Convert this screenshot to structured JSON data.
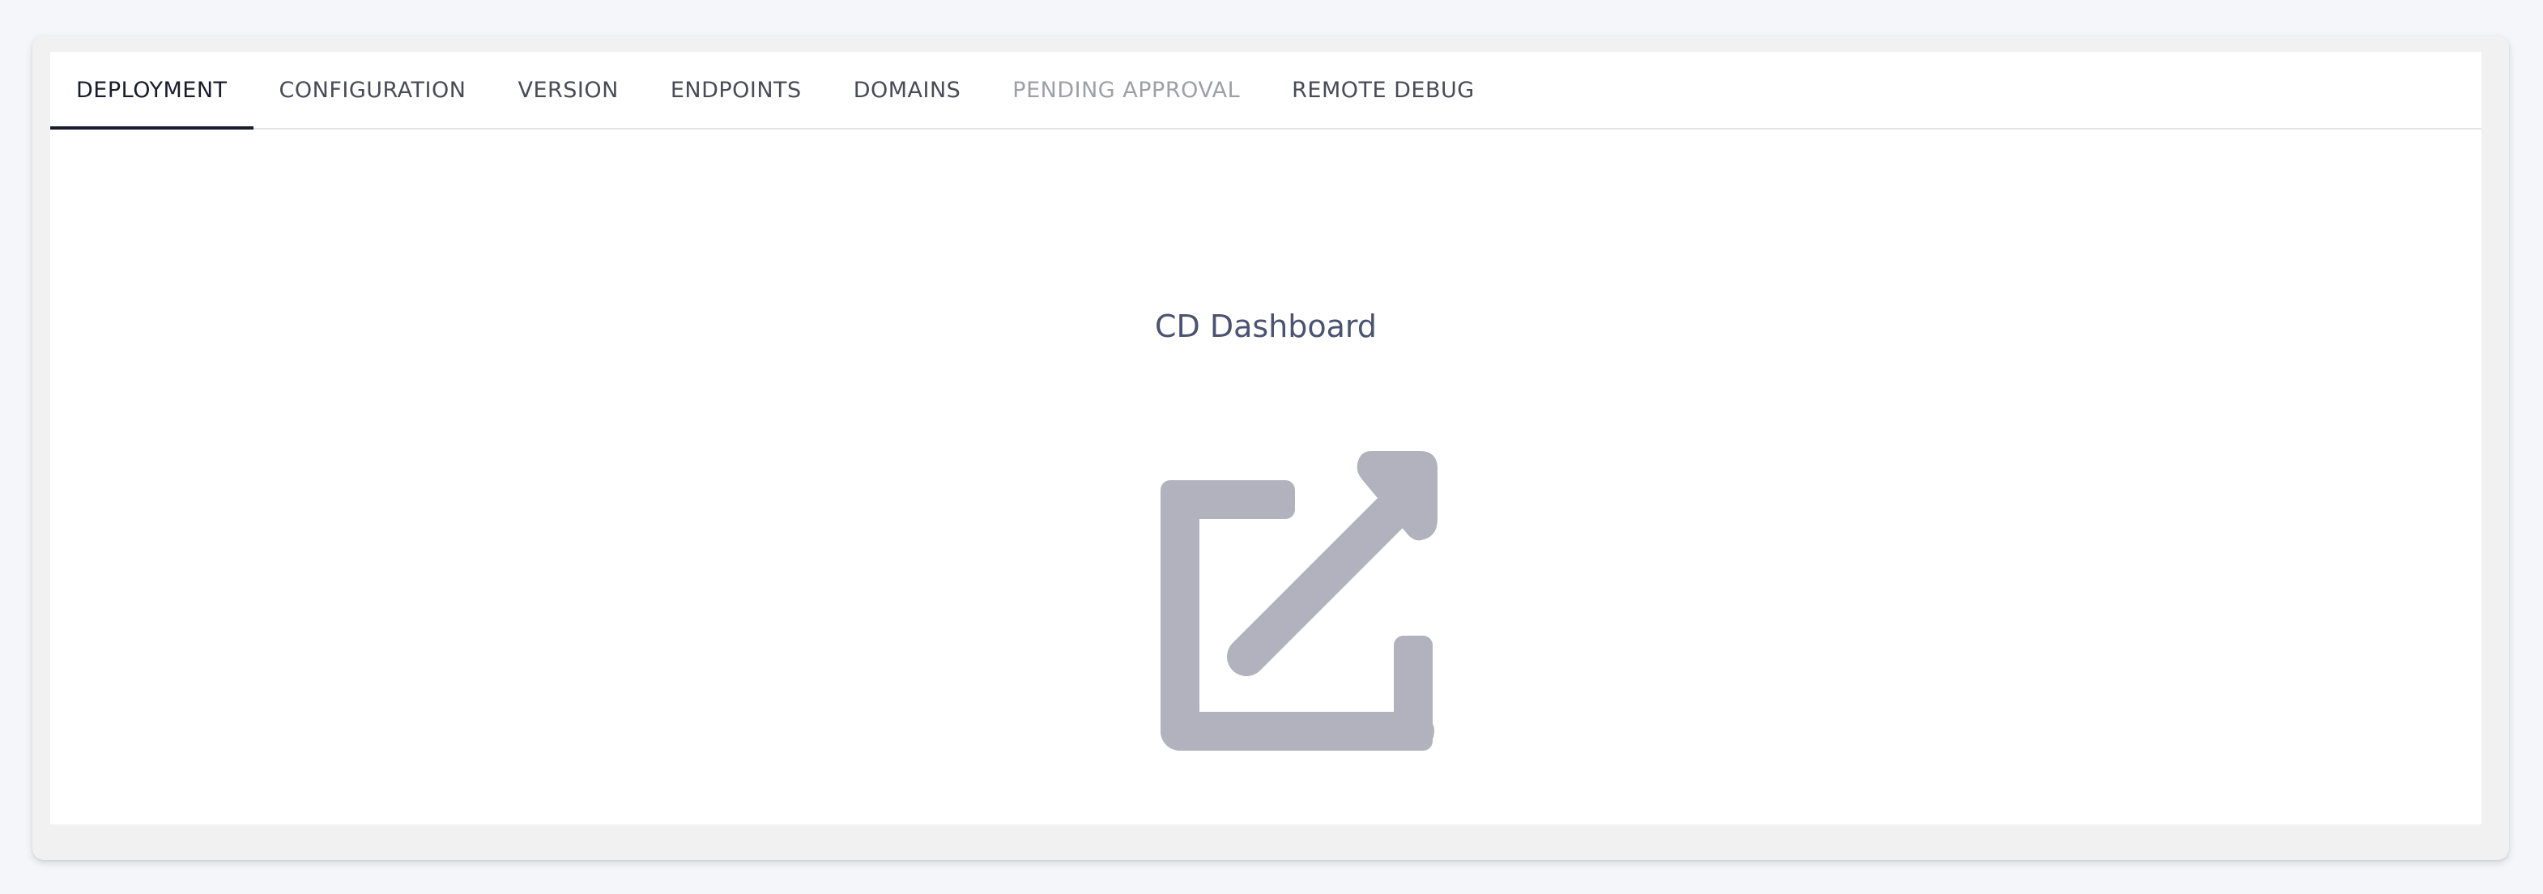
{
  "tabs": [
    {
      "label": "DEPLOYMENT",
      "state": "active"
    },
    {
      "label": "CONFIGURATION",
      "state": "normal"
    },
    {
      "label": "VERSION",
      "state": "normal"
    },
    {
      "label": "ENDPOINTS",
      "state": "normal"
    },
    {
      "label": "DOMAINS",
      "state": "normal"
    },
    {
      "label": "PENDING APPROVAL",
      "state": "disabled"
    },
    {
      "label": "REMOTE DEBUG",
      "state": "normal"
    }
  ],
  "main": {
    "title": "CD Dashboard",
    "link_icon": "external-link-icon",
    "icon_color": "#b1b2bd"
  },
  "colors": {
    "active_tab": "#1a1c2c",
    "tab_text": "#494b56",
    "disabled_tab": "#9fa0a7",
    "title_text": "#4a5370",
    "page_background": "#f5f6f9"
  }
}
